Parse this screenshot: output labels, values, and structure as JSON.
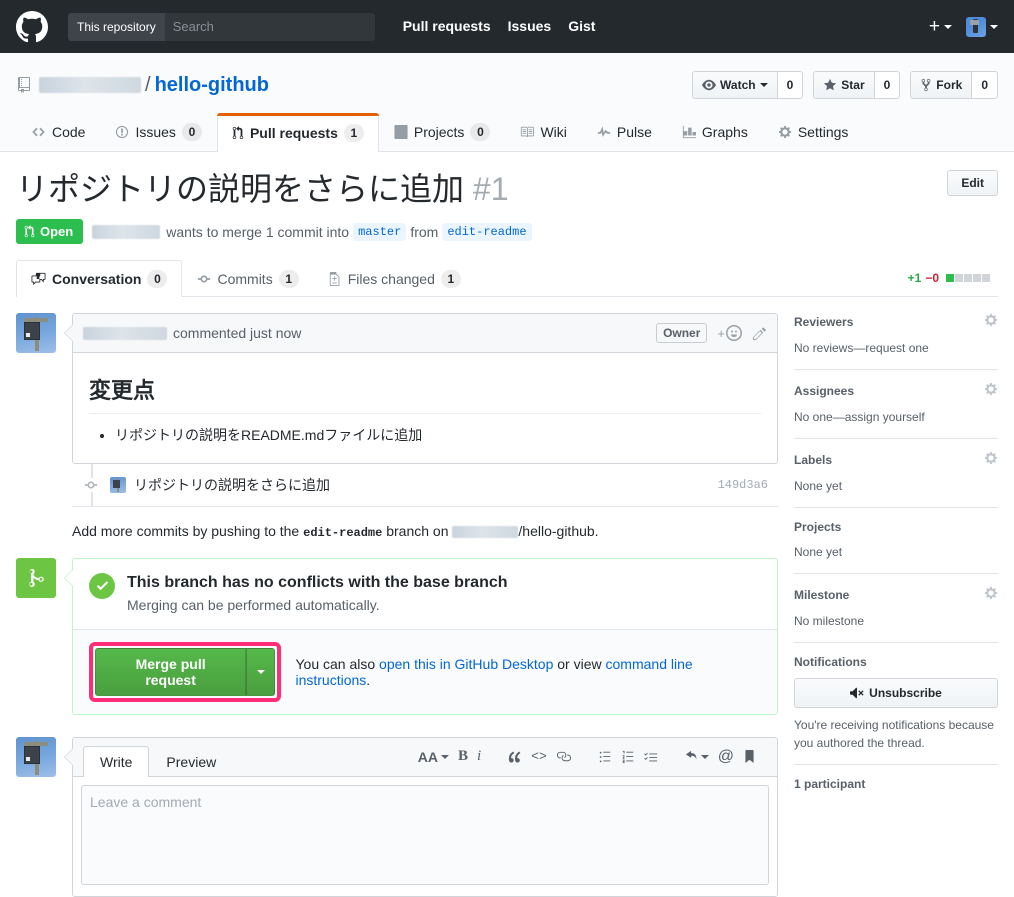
{
  "topnav": {
    "logo_icon": "github-mark-icon",
    "search_scope": "This repository",
    "search_placeholder": "Search",
    "links": [
      "Pull requests",
      "Issues",
      "Gist"
    ],
    "plus_icon": "plus-icon",
    "avatar_icon": "user-avatar"
  },
  "repo": {
    "owner": "",
    "separator": "/",
    "name": "hello-github",
    "repo_icon": "repo-icon",
    "actions": [
      {
        "label": "Watch",
        "count": "0",
        "icon": "eye-icon",
        "has_caret": true
      },
      {
        "label": "Star",
        "count": "0",
        "icon": "star-icon",
        "has_caret": false
      },
      {
        "label": "Fork",
        "count": "0",
        "icon": "fork-icon",
        "has_caret": false
      }
    ],
    "tabs": [
      {
        "label": "Code",
        "count": "",
        "icon": "code-icon",
        "selected": false
      },
      {
        "label": "Issues",
        "count": "0",
        "icon": "issue-opened-icon",
        "selected": false
      },
      {
        "label": "Pull requests",
        "count": "1",
        "icon": "git-pull-request-icon",
        "selected": true
      },
      {
        "label": "Projects",
        "count": "0",
        "icon": "project-icon",
        "selected": false
      },
      {
        "label": "Wiki",
        "count": "",
        "icon": "book-icon",
        "selected": false
      },
      {
        "label": "Pulse",
        "count": "",
        "icon": "pulse-icon",
        "selected": false
      },
      {
        "label": "Graphs",
        "count": "",
        "icon": "graph-icon",
        "selected": false
      },
      {
        "label": "Settings",
        "count": "",
        "icon": "gear-icon",
        "selected": false
      }
    ]
  },
  "pr": {
    "title": "リポジトリの説明をさらに追加",
    "number": "#1",
    "edit_label": "Edit",
    "state": "Open",
    "state_icon": "git-pull-request-icon",
    "meta_action": "wants to merge 1 commit into",
    "base_branch": "master",
    "meta_from": "from",
    "head_branch": "edit-readme",
    "tabs": [
      {
        "label": "Conversation",
        "count": "0",
        "icon": "comment-discussion-icon",
        "selected": true
      },
      {
        "label": "Commits",
        "count": "1",
        "icon": "git-commit-icon",
        "selected": false
      },
      {
        "label": "Files changed",
        "count": "1",
        "icon": "diff-icon",
        "selected": false
      }
    ],
    "diffstat": {
      "additions": "+1",
      "deletions": "−0",
      "blocks_on": 1,
      "blocks_total": 5
    }
  },
  "comment": {
    "author_redacted": true,
    "action_text": "commented just now",
    "owner_badge": "Owner",
    "reaction_icon": "add-reaction-icon",
    "edit_icon": "pencil-icon",
    "heading": "変更点",
    "bullets": [
      "リポジトリの説明をREADME.mdファイルに追加"
    ]
  },
  "commit": {
    "icon": "git-commit-icon",
    "message": "リポジトリの説明をさらに追加",
    "sha": "149d3a6"
  },
  "push_note": {
    "prefix": "Add more commits by pushing to the",
    "branch": "edit-readme",
    "middle": "branch on",
    "repo_suffix": "/hello-github."
  },
  "merge": {
    "badge_icon": "git-merge-icon",
    "check_icon": "check-icon",
    "title": "This branch has no conflicts with the base branch",
    "subtitle": "Merging can be performed automatically.",
    "button_label": "Merge pull request",
    "caret_icon": "chevron-down-icon",
    "note_prefix": "You can also",
    "note_link1": "open this in GitHub Desktop",
    "note_middle": "or view",
    "note_link2": "command line instructions",
    "note_suffix": ".",
    "highlight_color": "#ff2d78"
  },
  "form": {
    "tabs": [
      {
        "label": "Write",
        "selected": true
      },
      {
        "label": "Preview",
        "selected": false
      }
    ],
    "toolbar": [
      {
        "name": "text-size-icon",
        "glyph": "AA"
      },
      {
        "name": "bold-icon",
        "glyph": "B"
      },
      {
        "name": "italic-icon",
        "glyph": "i"
      },
      {
        "name": "quote-icon",
        "glyph": "❝"
      },
      {
        "name": "code-icon",
        "glyph": "<>"
      },
      {
        "name": "link-icon",
        "glyph": "🔗"
      },
      {
        "name": "unordered-list-icon",
        "glyph": "≔"
      },
      {
        "name": "ordered-list-icon",
        "glyph": "≕"
      },
      {
        "name": "task-list-icon",
        "glyph": "☑"
      },
      {
        "name": "reply-icon",
        "glyph": "↰"
      },
      {
        "name": "mention-icon",
        "glyph": "@"
      },
      {
        "name": "saved-replies-icon",
        "glyph": "🔖"
      }
    ],
    "placeholder": "Leave a comment"
  },
  "sidebar": {
    "sections": [
      {
        "title": "Reviewers",
        "value": "No reviews—request one",
        "gear": true
      },
      {
        "title": "Assignees",
        "value": "No one—assign yourself",
        "gear": true
      },
      {
        "title": "Labels",
        "value": "None yet",
        "gear": true
      },
      {
        "title": "Projects",
        "value": "None yet",
        "gear": false
      },
      {
        "title": "Milestone",
        "value": "No milestone",
        "gear": true
      }
    ],
    "notifications": {
      "title": "Notifications",
      "button_label": "Unsubscribe",
      "button_icon": "mute-icon",
      "note": "You're receiving notifications because you authored the thread."
    },
    "participants": "1 participant"
  },
  "colors": {
    "accent_blue": "#0366d6",
    "open_green": "#2cbe4e",
    "merge_green": "#6cc644",
    "highlight_pink": "#ff2d78",
    "nav_dark": "#24292e"
  }
}
